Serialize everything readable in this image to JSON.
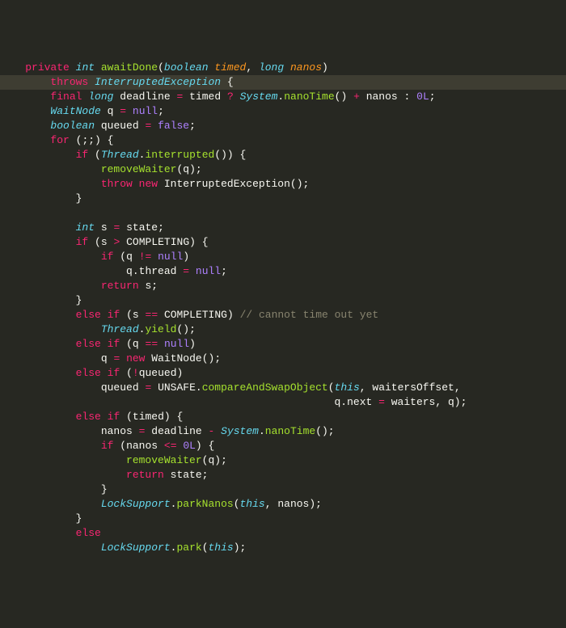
{
  "lines": {
    "l1_private": "private",
    "l1_int": "int",
    "l1_method": "awaitDone",
    "l1_boolean": "boolean",
    "l1_p1": "timed",
    "l1_long": "long",
    "l1_p2": "nanos",
    "l2_throws": "throws",
    "l2_exc": "InterruptedException",
    "l3_final": "final",
    "l3_long": "long",
    "l3_var": "deadline",
    "l3_eq": "=",
    "l3_timed": "timed",
    "l3_q": "?",
    "l3_sys": "System",
    "l3_nanoTime": "nanoTime",
    "l3_plus": "+",
    "l3_nanos": "nanos",
    "l3_colon": ":",
    "l3_zero": "0L",
    "l4_type": "WaitNode",
    "l4_var": "q",
    "l4_eq": "=",
    "l4_null": "null",
    "l5_boolean": "boolean",
    "l5_var": "queued",
    "l5_eq": "=",
    "l5_false": "false",
    "l6_for": "for",
    "l7_if": "if",
    "l7_thread": "Thread",
    "l7_interrupted": "interrupted",
    "l8_removeWaiter": "removeWaiter",
    "l8_q": "q",
    "l9_throw": "throw",
    "l9_new": "new",
    "l9_exc": "InterruptedException",
    "l12_int": "int",
    "l12_s": "s",
    "l12_eq": "=",
    "l12_state": "state",
    "l13_if": "if",
    "l13_s": "s",
    "l13_gt": ">",
    "l13_comp": "COMPLETING",
    "l14_if": "if",
    "l14_q": "q",
    "l14_neq": "!=",
    "l14_null": "null",
    "l15_q": "q",
    "l15_thread": "thread",
    "l15_eq": "=",
    "l15_null": "null",
    "l16_return": "return",
    "l16_s": "s",
    "l18_else": "else",
    "l18_if": "if",
    "l18_s": "s",
    "l18_eq": "==",
    "l18_comp": "COMPLETING",
    "l18_cm": "// cannot time out yet",
    "l19_thread": "Thread",
    "l19_yield": "yield",
    "l20_else": "else",
    "l20_if": "if",
    "l20_q": "q",
    "l20_eq": "==",
    "l20_null": "null",
    "l21_q": "q",
    "l21_eq": "=",
    "l21_new": "new",
    "l21_wn": "WaitNode",
    "l22_else": "else",
    "l22_if": "if",
    "l22_not": "!",
    "l22_queued": "queued",
    "l23_queued": "queued",
    "l23_eq": "=",
    "l23_unsafe": "UNSAFE",
    "l23_cas": "compareAndSwapObject",
    "l23_this": "this",
    "l23_wo": "waitersOffset",
    "l24_q": "q",
    "l24_next": "next",
    "l24_eq": "=",
    "l24_waiters": "waiters",
    "l24_q2": "q",
    "l25_else": "else",
    "l25_if": "if",
    "l25_timed": "timed",
    "l26_nanos": "nanos",
    "l26_eq": "=",
    "l26_deadline": "deadline",
    "l26_minus": "-",
    "l26_sys": "System",
    "l26_nanoTime": "nanoTime",
    "l27_if": "if",
    "l27_nanos": "nanos",
    "l27_le": "<=",
    "l27_zero": "0L",
    "l28_removeWaiter": "removeWaiter",
    "l28_q": "q",
    "l29_return": "return",
    "l29_state": "state",
    "l31_ls": "LockSupport",
    "l31_parkNanos": "parkNanos",
    "l31_this": "this",
    "l31_nanos": "nanos",
    "l33_else": "else",
    "l34_ls": "LockSupport",
    "l34_park": "park",
    "l34_this": "this"
  }
}
